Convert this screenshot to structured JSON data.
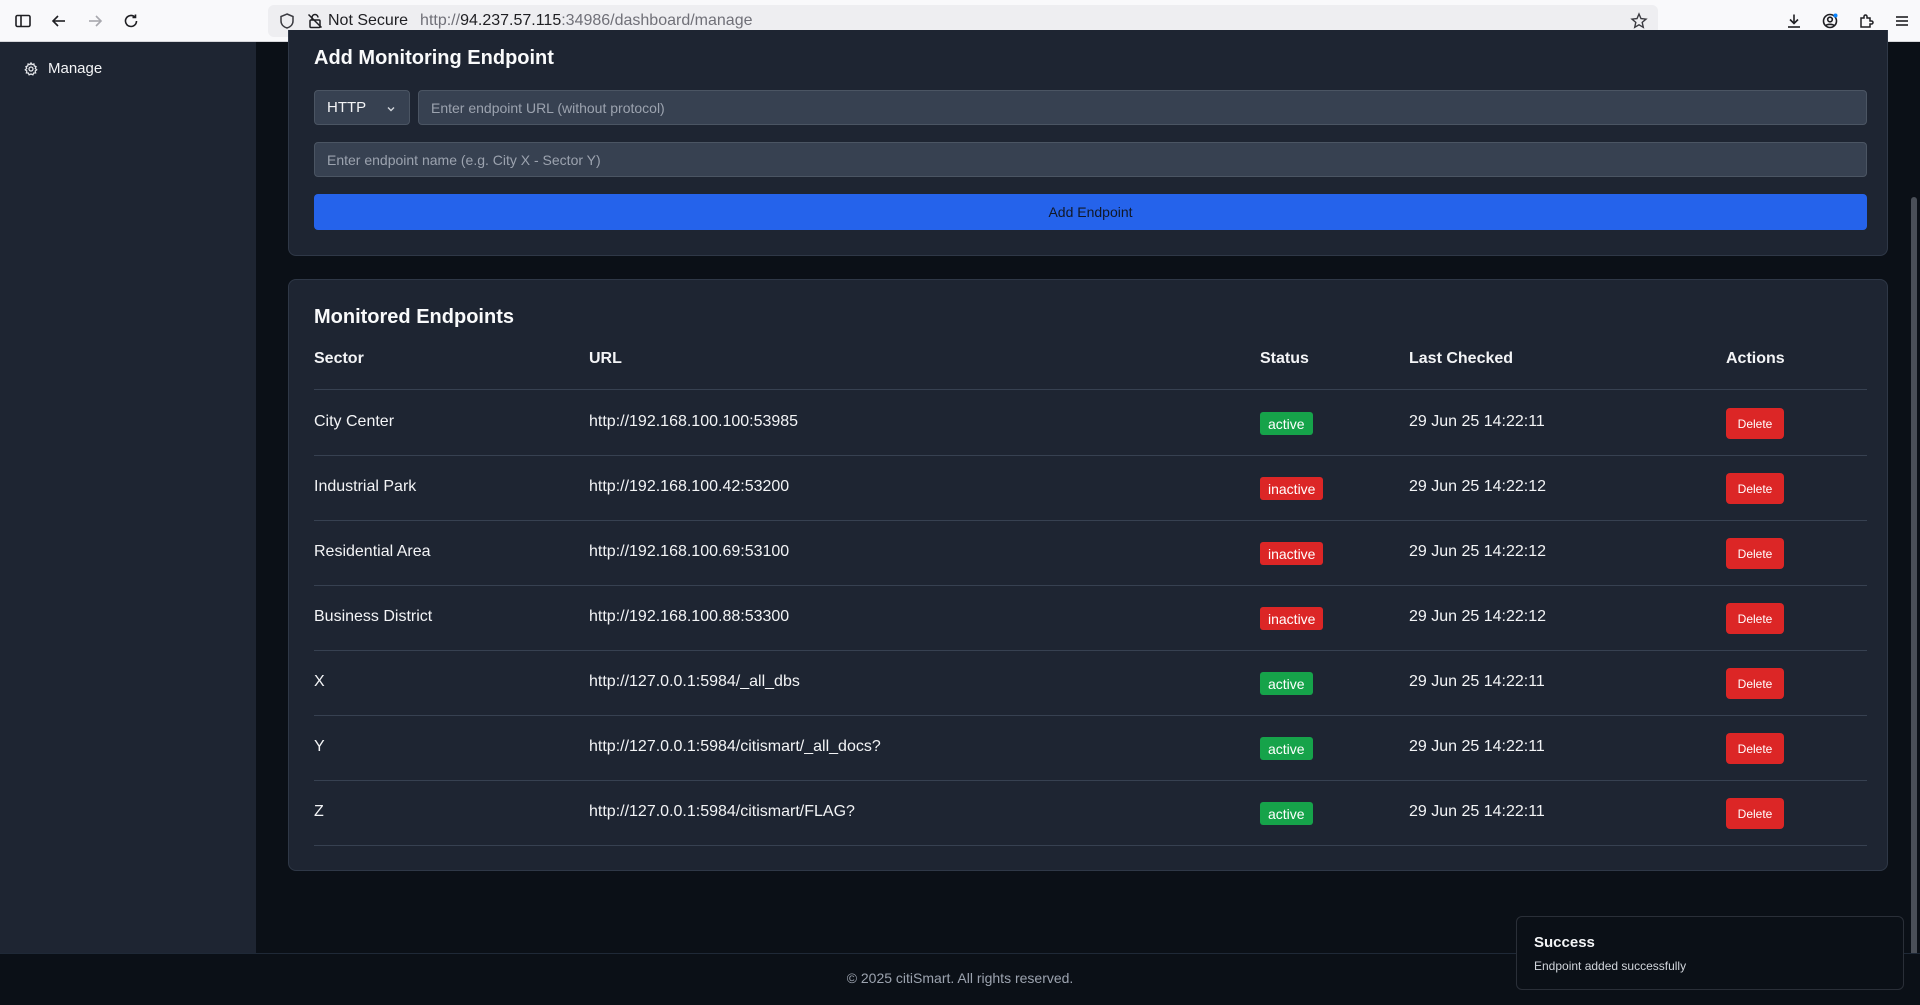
{
  "browser": {
    "security_label": "Not Secure",
    "url_prefix": "http://",
    "url_host": "94.237.57.115",
    "url_rest": ":34986/dashboard/manage"
  },
  "sidebar": {
    "items": [
      {
        "label": "Manage",
        "icon": "gear-icon"
      }
    ]
  },
  "add_form": {
    "title": "Add Monitoring Endpoint",
    "protocol": "HTTP",
    "url_placeholder": "Enter endpoint URL (without protocol)",
    "name_placeholder": "Enter endpoint name (e.g. City X - Sector Y)",
    "submit_label": "Add Endpoint"
  },
  "endpoints": {
    "title": "Monitored Endpoints",
    "columns": [
      "Sector",
      "URL",
      "Status",
      "Last Checked",
      "Actions"
    ],
    "delete_label": "Delete",
    "rows": [
      {
        "sector": "City Center",
        "url": "http://192.168.100.100:53985",
        "status": "active",
        "last_checked": "29 Jun 25 14:22:11"
      },
      {
        "sector": "Industrial Park",
        "url": "http://192.168.100.42:53200",
        "status": "inactive",
        "last_checked": "29 Jun 25 14:22:12"
      },
      {
        "sector": "Residential Area",
        "url": "http://192.168.100.69:53100",
        "status": "inactive",
        "last_checked": "29 Jun 25 14:22:12"
      },
      {
        "sector": "Business District",
        "url": "http://192.168.100.88:53300",
        "status": "inactive",
        "last_checked": "29 Jun 25 14:22:12"
      },
      {
        "sector": "X",
        "url": "http://127.0.0.1:5984/_all_dbs",
        "status": "active",
        "last_checked": "29 Jun 25 14:22:11"
      },
      {
        "sector": "Y",
        "url": "http://127.0.0.1:5984/citismart/_all_docs?",
        "status": "active",
        "last_checked": "29 Jun 25 14:22:11"
      },
      {
        "sector": "Z",
        "url": "http://127.0.0.1:5984/citismart/FLAG?",
        "status": "active",
        "last_checked": "29 Jun 25 14:22:11"
      }
    ]
  },
  "footer": {
    "text": "© 2025 citiSmart. All rights reserved."
  },
  "toast": {
    "title": "Success",
    "message": "Endpoint added successfully"
  },
  "colors": {
    "active": "#16a34a",
    "inactive": "#dc2626",
    "accent": "#2563eb"
  }
}
